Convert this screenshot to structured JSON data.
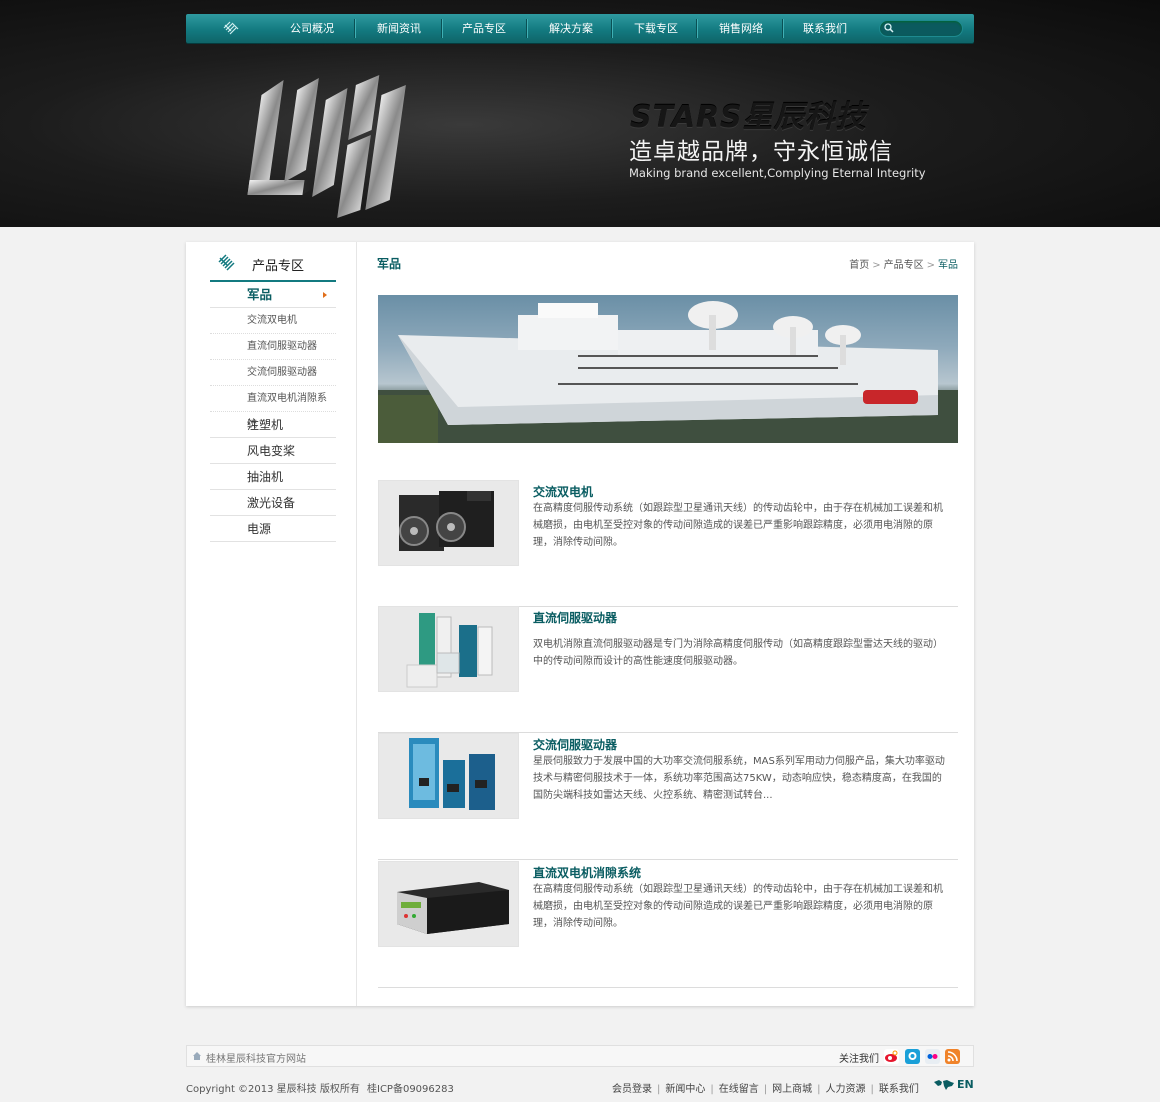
{
  "nav": {
    "items": [
      "公司概况",
      "新闻资讯",
      "产品专区",
      "解决方案",
      "下载专区",
      "销售网络",
      "联系我们"
    ],
    "search_placeholder": ""
  },
  "banner": {
    "brand": "STARS星辰科技",
    "slogan_cn": "造卓越品牌，守永恒诚信",
    "slogan_en": "Making brand excellent,Complying Eternal Integrity"
  },
  "sidebar": {
    "title": "产品专区",
    "items": [
      {
        "label": "军品",
        "type": "active"
      },
      {
        "label": "交流双电机",
        "type": "sub"
      },
      {
        "label": "直流伺服驱动器",
        "type": "sub"
      },
      {
        "label": "交流伺服驱动器",
        "type": "sub"
      },
      {
        "label": "直流双电机消隙系统",
        "type": "sub"
      },
      {
        "label": "注塑机",
        "type": "main"
      },
      {
        "label": "风电变桨",
        "type": "main"
      },
      {
        "label": "抽油机",
        "type": "main"
      },
      {
        "label": "激光设备",
        "type": "main"
      },
      {
        "label": "电源",
        "type": "main"
      }
    ]
  },
  "main": {
    "title": "军品",
    "breadcrumb": [
      "首页",
      "产品专区",
      "军品"
    ]
  },
  "products": [
    {
      "title": "交流双电机",
      "desc": "在高精度伺服传动系统（如跟踪型卫星通讯天线）的传动齿轮中，由于存在机械加工误差和机械磨损，由电机至受控对象的传动间隙造成的误差已严重影响跟踪精度，必须用电消隙的原理，消除传动间隙。"
    },
    {
      "title": "直流伺服驱动器",
      "desc": " 双电机消隙直流伺服驱动器是专门为消除高精度伺服传动（如高精度跟踪型雷达天线的驱动）中的传动间隙而设计的高性能速度伺服驱动器。"
    },
    {
      "title": "交流伺服驱动器",
      "desc": "星辰伺服致力于发展中国的大功率交流伺服系统，MAS系列军用动力伺服产品，集大功率驱动技术与精密伺服技术于一体，系统功率范围高达75KW，动态响应快，稳态精度高，在我国的国防尖端科技如雷达天线、火控系统、精密测试转台..."
    },
    {
      "title": "直流双电机消隙系统",
      "desc": "在高精度伺服传动系统（如跟踪型卫星通讯天线）的传动齿轮中，由于存在机械加工误差和机械磨损，由电机至受控对象的传动间隙造成的误差已严重影响跟踪精度，必须用电消隙的原理，消除传动间隙。"
    }
  ],
  "footer": {
    "site_name": "桂林星辰科技官方网站",
    "follow": "关注我们",
    "copyright": "Copyright ©2013  星辰科技  版权所有",
    "icp": "桂ICP备09096283",
    "links": [
      "会员登录",
      "新闻中心",
      "在线留言",
      "网上商城",
      "人力资源",
      "联系我们"
    ],
    "lang": "EN"
  },
  "colors": {
    "accent": "#137a80",
    "title": "#0a5d62",
    "arrow": "#e06e1a"
  }
}
